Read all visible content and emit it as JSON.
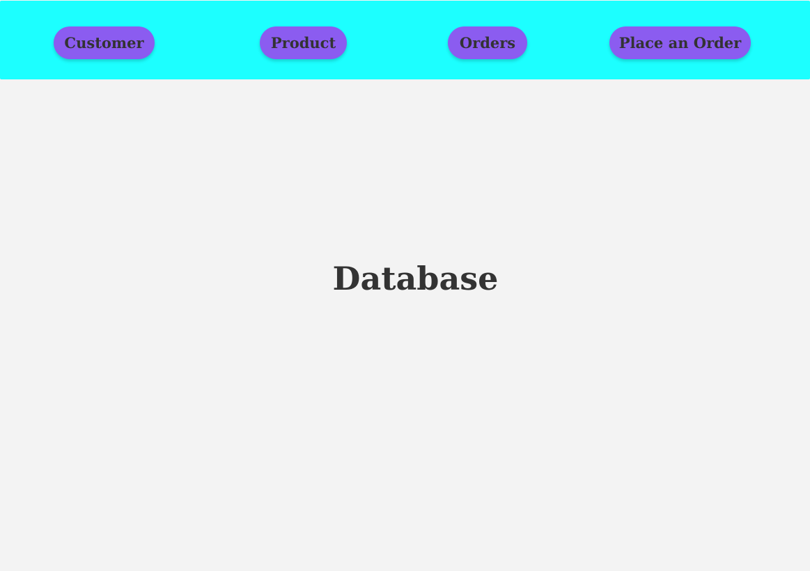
{
  "header": {
    "nav_items": [
      {
        "label": "Customer"
      },
      {
        "label": "Product"
      },
      {
        "label": "Orders"
      },
      {
        "label": "Place an Order"
      }
    ]
  },
  "main": {
    "title": "Database"
  },
  "colors": {
    "header_background": "#1cffff",
    "button_background": "#8b5cf0",
    "text": "#333333",
    "page_background": "#f3f3f3"
  }
}
